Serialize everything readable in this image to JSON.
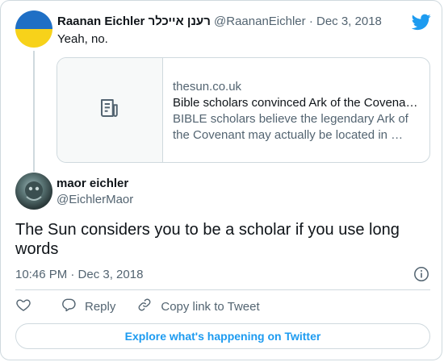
{
  "parent_tweet": {
    "display_name": "Raanan Eichler",
    "display_name_hebrew": "רענן אייכלר",
    "handle": "@RaananEichler",
    "separator": "·",
    "date": "Dec 3, 2018",
    "text": "Yeah, no.",
    "link_card": {
      "domain": "thesun.co.uk",
      "title": "Bible scholars convinced Ark of the Covenant may actually be located in …",
      "description": "BIBLE scholars believe the legendary Ark of the Covenant may actually be located in …"
    }
  },
  "main_tweet": {
    "display_name": "maor eichler",
    "handle": "@EichlerMaor",
    "text": "The Sun considers you to be a scholar if you use long words",
    "timestamp": "10:46 PM · Dec 3, 2018"
  },
  "actions": {
    "reply_label": "Reply",
    "copy_link_label": "Copy link to Tweet"
  },
  "explore_label": "Explore what's happening on Twitter",
  "colors": {
    "twitter_blue": "#1d9bf0",
    "text_primary": "#0f1419",
    "text_secondary": "#536471",
    "border": "#cfd9de"
  },
  "icons": [
    "twitter-bird-icon",
    "article-icon",
    "info-icon",
    "heart-icon",
    "reply-icon",
    "link-icon"
  ]
}
